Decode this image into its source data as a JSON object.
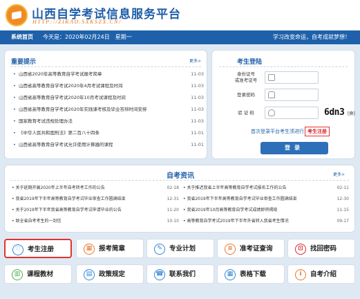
{
  "header": {
    "title": "山西自学考试信息服务平台",
    "url": "HTTP://ZIKAO.SXKSZX.CN/"
  },
  "navbar": {
    "home": "系统首页",
    "date": "今天是：2020年02月24日　星期一",
    "slogan": "学习改变命运，自考成就梦想！"
  },
  "notice": {
    "title": "重要提示",
    "more": "更多>",
    "items": [
      {
        "text": "山西省2020年高等教育自学考试报考简章",
        "date": "11-03"
      },
      {
        "text": "山西省高等教育自学考试2020年4月考试课程及时间",
        "date": "11-03"
      },
      {
        "text": "山西省高等教育自学考试2020年10月考试课程及时间",
        "date": "11-03"
      },
      {
        "text": "山西省高等教育自学考试2020年实践课考核及毕业答辩时间安排",
        "date": "11-03"
      },
      {
        "text": "国家教育考试违规处理办法",
        "date": "11-03"
      },
      {
        "text": "《中华人民共和国刑法》第二百八十四条",
        "date": "11-01"
      },
      {
        "text": "山西省高等教育自学考试允许使用计算器的课程",
        "date": "11-01"
      }
    ]
  },
  "login": {
    "title": "考生登陆",
    "id_label": "身份证号\n或准考证号",
    "password_label": "登录密码",
    "captcha_label": "验 证 码",
    "captcha_value": "6dn3",
    "refresh": "[换]",
    "first_login": "首次登录平台考生须进行",
    "register": "考生注册",
    "submit": "登录"
  },
  "news": {
    "title": "自考资讯",
    "more": "更多>",
    "left": [
      {
        "text": "关于延期开展2020年上半年自考转考工作的公告",
        "date": "02-18"
      },
      {
        "text": "我省2019年下半年高等教育自学考试毕业审查工作圆满结束",
        "date": "12-31"
      },
      {
        "text": "关于2019年下半年我省高等教育自学考试申请毕业的公告",
        "date": "11-20"
      },
      {
        "text": "致全省自考考生的一封信",
        "date": "10-10"
      }
    ],
    "right": [
      {
        "text": "关于推迟我省上半年高等教育自学考试报名工作的公告",
        "date": "02-11"
      },
      {
        "text": "我省2019年下半年高等教育自学考试毕业审查工作圆满结束",
        "date": "12-30"
      },
      {
        "text": "我省2019年10月高等教育自学考试成绩即将揭晓",
        "date": "11-15"
      },
      {
        "text": "高等教育自学考试2019年下半年外省转入我省考生情况",
        "date": "09-17"
      }
    ]
  },
  "quick_links": [
    {
      "label": "考生注册",
      "icon": "user-heart-icon",
      "color": "#2e86d6",
      "glyph": "♡"
    },
    {
      "label": "报考简章",
      "icon": "calendar-icon",
      "color": "#e8762b",
      "glyph": "▦"
    },
    {
      "label": "专业计划",
      "icon": "clipboard-icon",
      "color": "#2e86d6",
      "glyph": "✎"
    },
    {
      "label": "准考证查询",
      "icon": "id-card-icon",
      "color": "#e8762b",
      "glyph": "≡"
    },
    {
      "label": "找回密码",
      "icon": "lock-icon",
      "color": "#d6262c",
      "glyph": "⊡"
    },
    {
      "label": "课程教材",
      "icon": "book-icon",
      "color": "#4caf50",
      "glyph": "▥"
    },
    {
      "label": "政策规定",
      "icon": "document-icon",
      "color": "#2e86d6",
      "glyph": "▤"
    },
    {
      "label": "联系我们",
      "icon": "phone-icon",
      "color": "#2e86d6",
      "glyph": "☎"
    },
    {
      "label": "表格下载",
      "icon": "table-icon",
      "color": "#2e86d6",
      "glyph": "▦"
    },
    {
      "label": "自考介绍",
      "icon": "info-icon",
      "color": "#e8762b",
      "glyph": "i"
    }
  ]
}
